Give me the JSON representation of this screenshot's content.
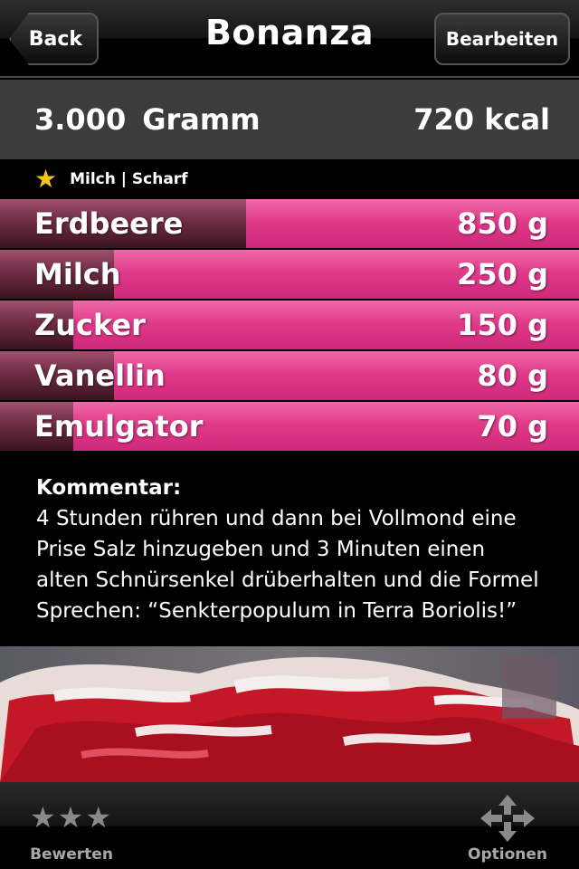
{
  "nav": {
    "title": "Bonanza",
    "back_label": "Back",
    "edit_label": "Bearbeiten"
  },
  "summary": {
    "weight_value": "3.000",
    "weight_unit": "Gramm",
    "calories": "720 kcal"
  },
  "tags": {
    "label": "Milch | Scharf"
  },
  "ingredients": [
    {
      "name": "Erdbeere",
      "amount": "850 g",
      "share": 0.425
    },
    {
      "name": "Milch",
      "amount": "250 g",
      "share": 0.197
    },
    {
      "name": "Zucker",
      "amount": "150 g",
      "share": 0.127
    },
    {
      "name": "Vanellin",
      "amount": "80 g",
      "share": 0.197
    },
    {
      "name": "Emulgator",
      "amount": "70 g",
      "share": 0.127
    }
  ],
  "comment": {
    "label": "Kommentar:",
    "lines": [
      "4 Stunden rühren und dann bei Vollmond eine",
      "Prise Salz hinzugeben und 3 Minuten einen",
      "alten Schnürsenkel drüberhalten und die Formel",
      "Sprechen: “Senkterpopulum in Terra Boriolis!”"
    ]
  },
  "tabbar": {
    "rate_label": "Bewerten",
    "options_label": "Optionen"
  },
  "icons": {
    "favorite": "star-icon",
    "rate": "stars-icon",
    "options": "move-arrows-icon"
  },
  "colors": {
    "accent_pink": "#e03a8a",
    "dark_bar": "#6e2c44",
    "star_gold": "#f5c518"
  }
}
